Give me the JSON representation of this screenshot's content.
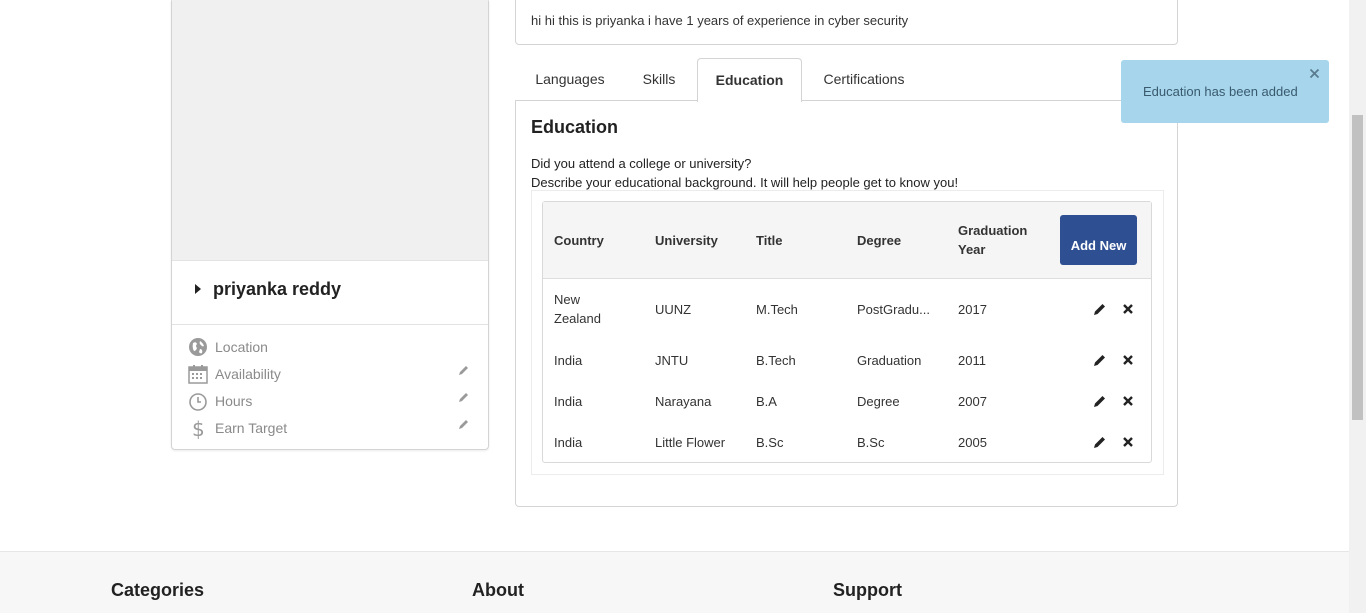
{
  "profile": {
    "name": "priyanka reddy",
    "attributes": [
      {
        "label": "Location",
        "icon": "globe-icon",
        "editable": false
      },
      {
        "label": "Availability",
        "icon": "calendar-icon",
        "editable": true
      },
      {
        "label": "Hours",
        "icon": "clock-icon",
        "editable": true
      },
      {
        "label": "Earn Target",
        "icon": "dollar-icon",
        "editable": true
      }
    ]
  },
  "bio": "hi hi this is priyanka i have 1 years of experience in cyber security",
  "tabs": [
    {
      "label": "Languages",
      "active": false
    },
    {
      "label": "Skills",
      "active": false
    },
    {
      "label": "Education",
      "active": true
    },
    {
      "label": "Certifications",
      "active": false
    }
  ],
  "education": {
    "title": "Education",
    "question": "Did you attend a college or university?",
    "description": "Describe your educational background. It will help people get to know you!",
    "columns": [
      "Country",
      "University",
      "Title",
      "Degree",
      "Graduation Year"
    ],
    "add_button": "Add New",
    "rows": [
      {
        "country": "New Zealand",
        "university": "UUNZ",
        "title": "M.Tech",
        "degree": "PostGradu...",
        "year": "2017"
      },
      {
        "country": "India",
        "university": "JNTU",
        "title": "B.Tech",
        "degree": "Graduation",
        "year": "2011"
      },
      {
        "country": "India",
        "university": "Narayana",
        "title": "B.A",
        "degree": "Degree",
        "year": "2007"
      },
      {
        "country": "India",
        "university": "Little Flower",
        "title": "B.Sc",
        "degree": "B.Sc",
        "year": "2005"
      }
    ]
  },
  "toast": {
    "message": "Education has been added",
    "color": "#a6d5ec"
  },
  "footer": {
    "columns": [
      "Categories",
      "About",
      "Support"
    ]
  },
  "colors": {
    "accent": "#2e4f92",
    "panel_bg": "#f0f0f0"
  }
}
